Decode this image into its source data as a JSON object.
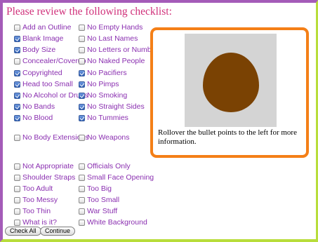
{
  "heading": "Please review the following checklist:",
  "left_column": [
    {
      "label": "Add an Outline",
      "checked": false
    },
    {
      "label": "Blank Image",
      "checked": true
    },
    {
      "label": "Body Size",
      "checked": true
    },
    {
      "label": "Concealer/Coverup",
      "checked": false
    },
    {
      "label": "Copyrighted",
      "checked": true
    },
    {
      "label": "Head too Small",
      "checked": true
    },
    {
      "label": "No Alcohol or Drugs",
      "checked": true
    },
    {
      "label": "No Bands",
      "checked": true
    },
    {
      "label": "No Blood",
      "checked": true
    },
    {
      "label": "No Body Extensions",
      "checked": false
    },
    {
      "label": "Not Appropriate",
      "checked": false
    },
    {
      "label": "Shoulder Straps",
      "checked": false
    },
    {
      "label": "Too Adult",
      "checked": false
    },
    {
      "label": "Too Messy",
      "checked": false
    },
    {
      "label": "Too Thin",
      "checked": false
    },
    {
      "label": "What is it?",
      "checked": false
    }
  ],
  "right_column": [
    {
      "label": "No Empty Hands",
      "checked": false
    },
    {
      "label": "No Last Names",
      "checked": false
    },
    {
      "label": "No Letters or Numbers",
      "checked": false
    },
    {
      "label": "No Naked People",
      "checked": false
    },
    {
      "label": "No Pacifiers",
      "checked": true
    },
    {
      "label": "No Pimps",
      "checked": true
    },
    {
      "label": "No Smoking",
      "checked": true
    },
    {
      "label": "No Straight Sides",
      "checked": true
    },
    {
      "label": "No Tummies",
      "checked": true
    },
    {
      "label": "No Weapons",
      "checked": false
    },
    {
      "label": "Officials Only",
      "checked": false
    },
    {
      "label": "Small Face Opening",
      "checked": false
    },
    {
      "label": "Too Big",
      "checked": false
    },
    {
      "label": "Too Small",
      "checked": false
    },
    {
      "label": "War Stuff",
      "checked": false
    },
    {
      "label": "White Background",
      "checked": false
    }
  ],
  "preview": {
    "info_text": "Rollover the bullet points to the left for more information."
  },
  "buttons": {
    "check_all": "Check All",
    "continue": "Continue"
  },
  "colors": {
    "heading": "#d0307a",
    "label": "#8a2fb0",
    "preview_border": "#f47f17",
    "shape_fill": "#7a4203",
    "frame_left_top": "#a45bb8",
    "frame_right_bottom": "#b8dd3b"
  }
}
